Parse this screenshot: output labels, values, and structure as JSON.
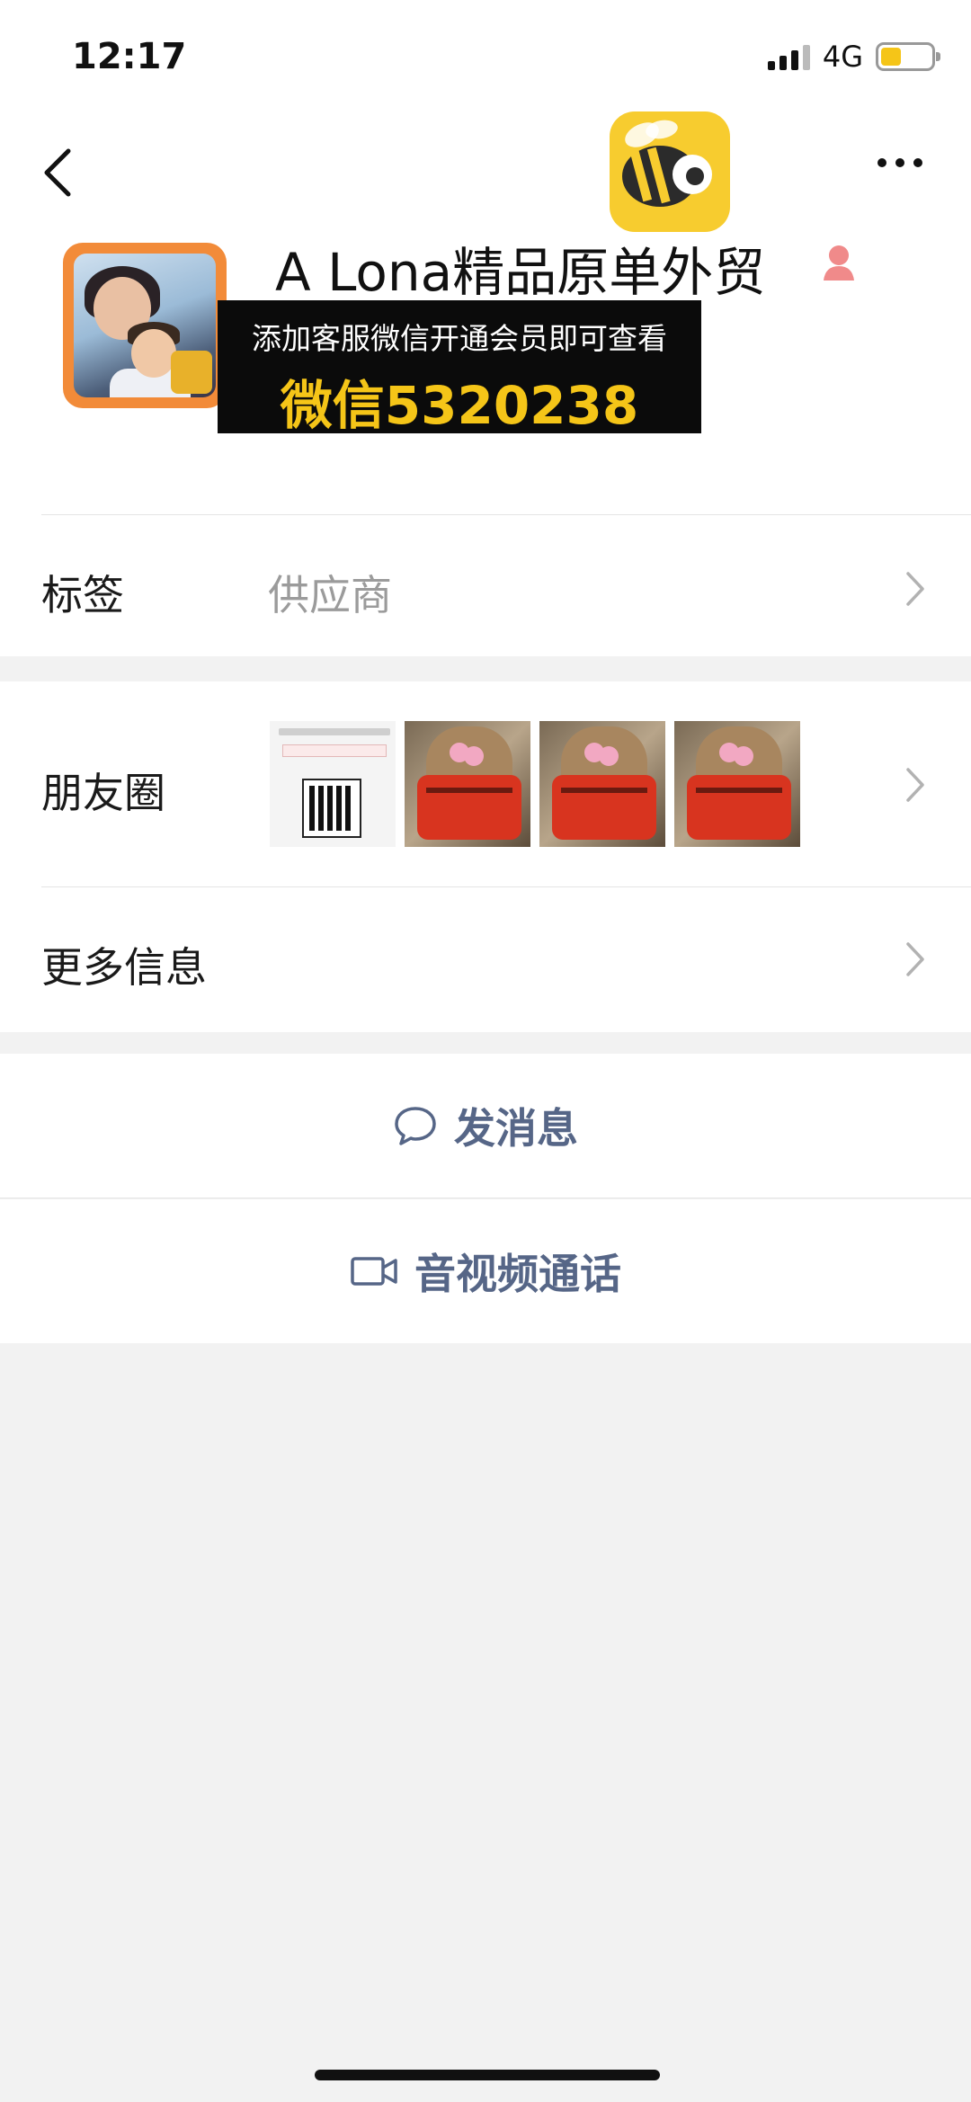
{
  "status_bar": {
    "time": "12:17",
    "network": "4G"
  },
  "profile": {
    "name": "A Lona精品原单外贸",
    "promo_line1": "添加客服微信开通会员即可查看",
    "promo_line2": "微信5320238"
  },
  "rows": {
    "tag": {
      "label": "标签",
      "value": "供应商"
    },
    "moments": {
      "label": "朋友圈"
    },
    "more_info": {
      "label": "更多信息"
    }
  },
  "actions": {
    "send_message": "发消息",
    "av_call": "音视频通话"
  },
  "colors": {
    "link_blue": "#566687",
    "promo_yellow": "#f5c518",
    "avatar_border": "#f28b39",
    "background": "#f2f2f2"
  }
}
